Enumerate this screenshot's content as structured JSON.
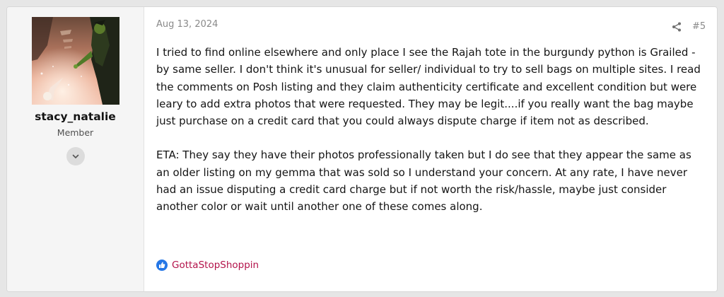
{
  "user": {
    "username": "stacy_natalie",
    "title": "Member",
    "avatar_icon": "avatar-image",
    "expand_icon": "chevron-down-icon"
  },
  "post": {
    "date": "Aug 13, 2024",
    "number": "#5",
    "share_icon": "share-icon",
    "paragraphs": [
      "I tried to find online elsewhere and only place I see the Rajah tote in the burgundy python is Grailed - by same seller. I don't think it's unusual for seller/ individual to try to sell bags on multiple sites. I read the comments on Posh listing and they claim authenticity certificate and excellent condition but were leary to add extra photos that were requested. They may be legit....if you really want the bag maybe just purchase on a credit card that you could always dispute charge if item not as described.",
      "ETA: They say they have their photos professionally taken but I do see that they appear the same as an older listing on my gemma that was sold so I understand your concern. At any rate, I have never had an issue disputing a credit card charge but if not worth the risk/hassle, maybe just consider another color or wait until another one of these comes along."
    ]
  },
  "reactions": {
    "icon": "like-icon",
    "users": "GottaStopShoppin"
  },
  "colors": {
    "accent_link": "#b3124a",
    "like_blue": "#2577e6",
    "user_panel_bg": "#f5f5f5"
  }
}
